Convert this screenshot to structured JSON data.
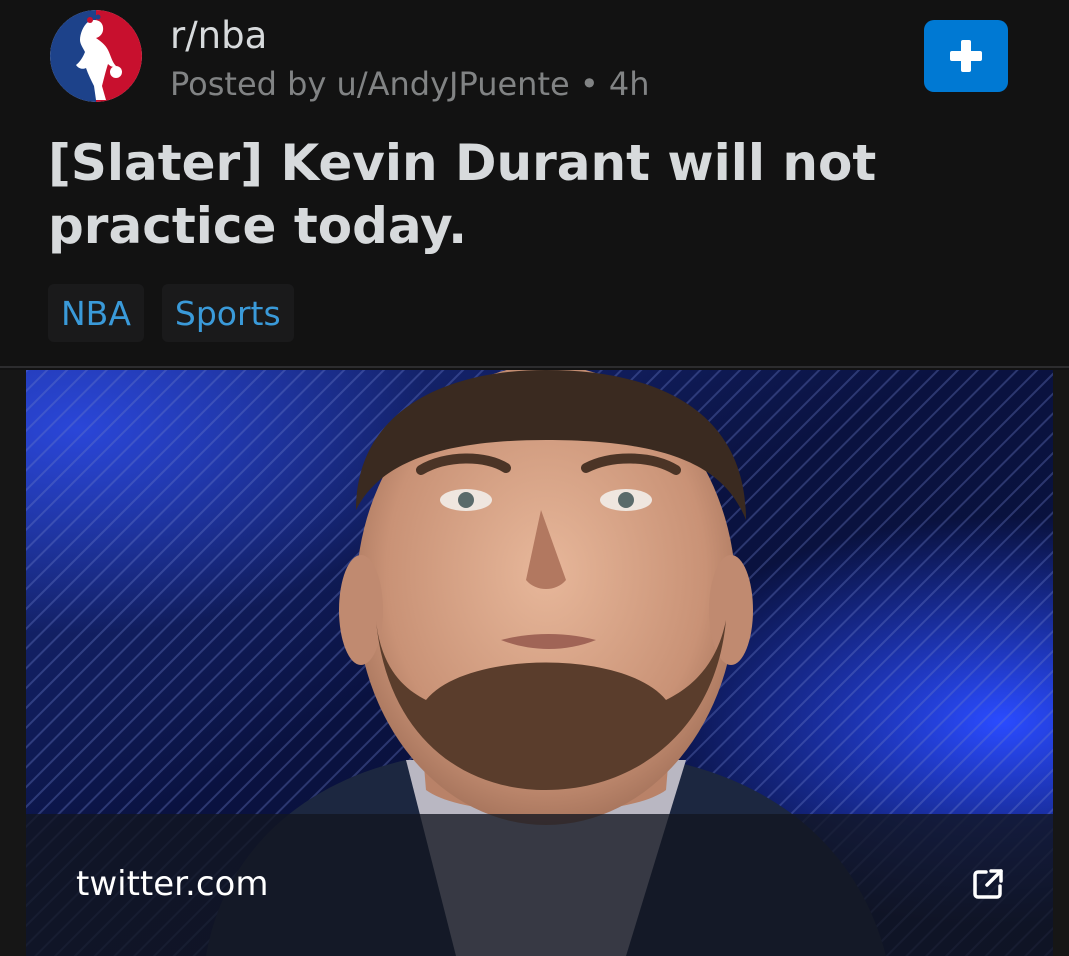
{
  "post": {
    "subreddit": "r/nba",
    "meta": "Posted by u/AndyJPuente • 4h",
    "title": "[Slater] Kevin Durant will not practice today.",
    "flairs": [
      "NBA",
      "Sports"
    ],
    "join_icon": "plus-icon",
    "link": {
      "domain": "twitter.com",
      "icon": "external-link-icon"
    }
  },
  "colors": {
    "background": "#121212",
    "accent": "#0079d3",
    "flair_text": "#3a9ad9",
    "meta_text": "#818384"
  }
}
